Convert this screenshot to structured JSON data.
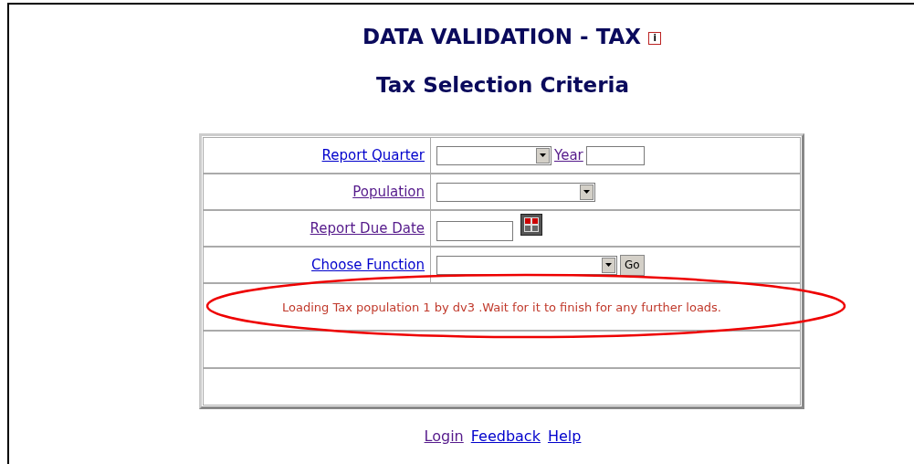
{
  "title": "DATA VALIDATION - TAX",
  "info_icon": "i",
  "subtitle": "Tax Selection Criteria",
  "rows": [
    {
      "label": "Report Quarter",
      "visited": false,
      "kind": "quarter",
      "extra_link": {
        "label": "Year",
        "visited": true
      }
    },
    {
      "label": "Population",
      "visited": true,
      "kind": "select"
    },
    {
      "label": "Report Due Date",
      "visited": true,
      "kind": "date"
    },
    {
      "label": "Choose Function",
      "visited": false,
      "kind": "function",
      "button": "Go"
    }
  ],
  "message": "Loading Tax population 1 by dv3 .Wait for it to finish for any further loads.",
  "message_highlighted": true,
  "footer_links": [
    {
      "label": "Login",
      "visited": true
    },
    {
      "label": "Feedback",
      "visited": false
    },
    {
      "label": "Help",
      "visited": false
    }
  ]
}
